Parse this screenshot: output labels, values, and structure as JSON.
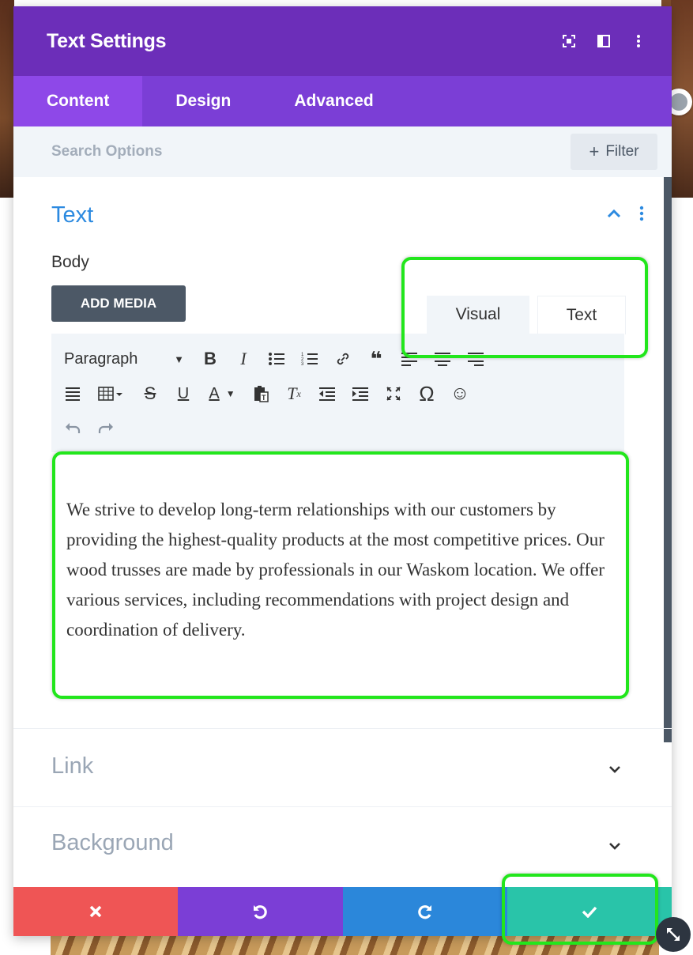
{
  "header": {
    "title": "Text Settings",
    "icons": [
      "screen-icon",
      "sidebar-icon",
      "more-icon"
    ]
  },
  "tabs": [
    {
      "label": "Content",
      "active": true
    },
    {
      "label": "Design",
      "active": false
    },
    {
      "label": "Advanced",
      "active": false
    }
  ],
  "search": {
    "placeholder": "Search Options",
    "filter_label": "Filter"
  },
  "text_section": {
    "title": "Text",
    "body_label": "Body",
    "add_media": "ADD MEDIA",
    "editor_tabs": {
      "visual": "Visual",
      "text": "Text"
    },
    "format_select": "Paragraph",
    "body_text": "We strive to develop long-term relationships with our customers by providing the highest-quality products at the most competitive prices. Our wood trusses are made by professionals in our Waskom location. We offer various services, including recommendations with project design and coordination of delivery."
  },
  "collapsed_sections": [
    {
      "title": "Link"
    },
    {
      "title": "Background"
    }
  ],
  "footer": {
    "buttons": [
      "close-icon",
      "undo-icon",
      "redo-icon",
      "check-icon"
    ]
  },
  "colors": {
    "header": "#6c2eb9",
    "tabs": "#7b3ed6",
    "active_tab": "#8e48e8",
    "accent_blue": "#2c8ae0",
    "highlight": "#22e61c",
    "close": "#ef5555",
    "undo": "#7b3ed6",
    "redo": "#2b87da",
    "save": "#29c4a9"
  }
}
